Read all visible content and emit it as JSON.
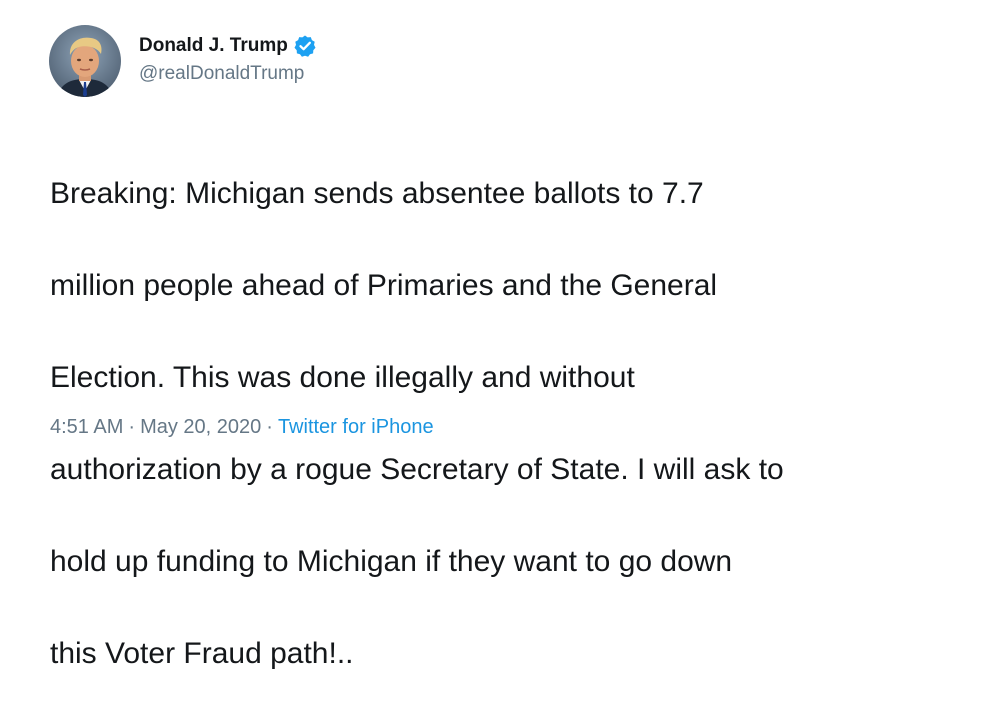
{
  "author": {
    "display_name": "Donald J. Trump",
    "handle": "@realDonaldTrump",
    "avatar_icon": "profile-photo",
    "verified_icon": "verified-badge-icon",
    "verified_color": "#1da1f2"
  },
  "tweet": {
    "lines": [
      "Breaking: Michigan sends absentee ballots to 7.7",
      "million people ahead of Primaries and the General",
      "Election. This was done illegally and without",
      "authorization by a rogue Secretary of State. I will ask to",
      "hold up funding to Michigan if they want to go down",
      "this Voter Fraud path!.."
    ]
  },
  "meta": {
    "time": "4:51 AM",
    "separator": "·",
    "date": "May 20, 2020",
    "source": "Twitter for iPhone",
    "source_color": "#1b95e0",
    "muted_color": "#657786"
  }
}
